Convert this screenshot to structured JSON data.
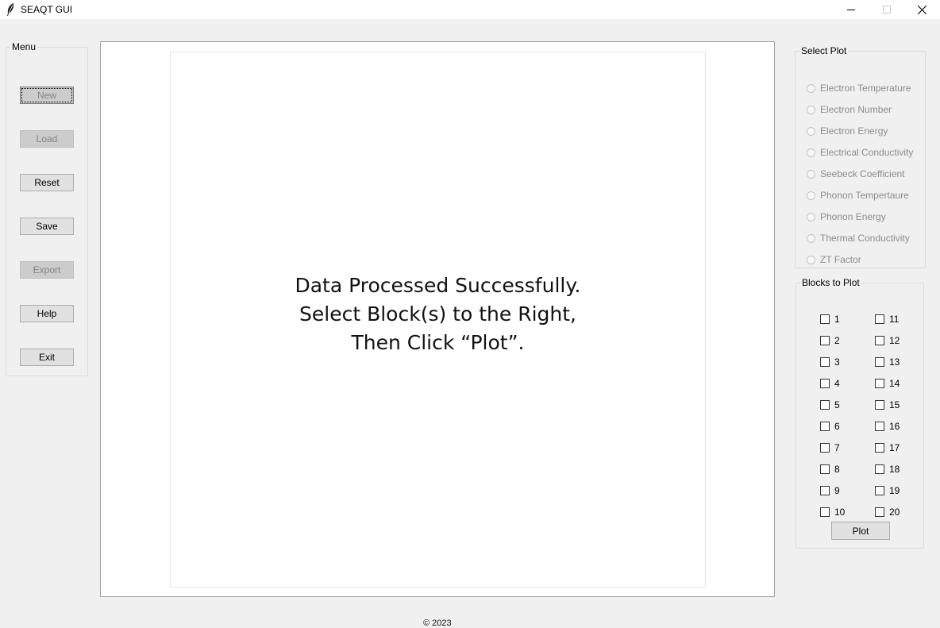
{
  "window": {
    "title": "SEAQT GUI"
  },
  "menu": {
    "legend": "Menu",
    "buttons": [
      {
        "label": "New",
        "state": "disabled-focused"
      },
      {
        "label": "Load",
        "state": "disabled"
      },
      {
        "label": "Reset",
        "state": "enabled"
      },
      {
        "label": "Save",
        "state": "enabled"
      },
      {
        "label": "Export",
        "state": "disabled"
      },
      {
        "label": "Help",
        "state": "enabled"
      },
      {
        "label": "Exit",
        "state": "enabled"
      }
    ]
  },
  "canvas": {
    "message_lines": [
      "Data Processed Successfully.",
      "Select Block(s) to the Right,",
      "Then Click “Plot”."
    ]
  },
  "select_plot": {
    "legend": "Select Plot",
    "options": [
      "Electron Temperature",
      "Electron Number",
      "Electron Energy",
      "Electrical Conductivity",
      "Seebeck Coefficient",
      "Phonon Tempertaure",
      "Phonon Energy",
      "Thermal Conductivity",
      "ZT Factor"
    ]
  },
  "blocks": {
    "legend": "Blocks to Plot",
    "left": [
      "1",
      "2",
      "3",
      "4",
      "5",
      "6",
      "7",
      "8",
      "9",
      "10"
    ],
    "right": [
      "11",
      "12",
      "13",
      "14",
      "15",
      "16",
      "17",
      "18",
      "19",
      "20"
    ],
    "plot_label": "Plot"
  },
  "footer": {
    "text": "© 2023"
  },
  "icons": {
    "app": "feather-icon",
    "minimize": "minimize-icon",
    "maximize": "maximize-icon",
    "close": "close-icon"
  }
}
